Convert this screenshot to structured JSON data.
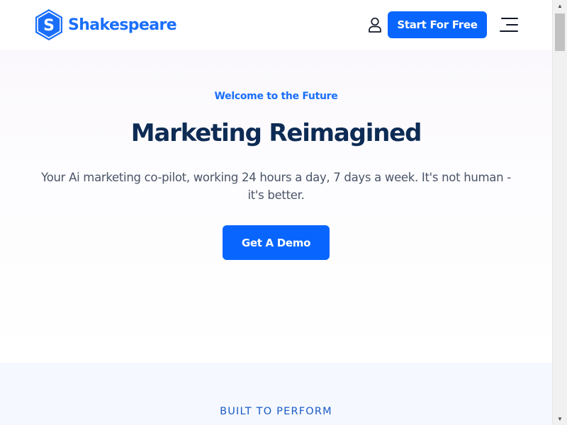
{
  "header": {
    "logo_text": "Shakespeare",
    "logo_letter": "S",
    "cta_label": "Start For Free",
    "account_icon": "user-icon",
    "menu_icon": "hamburger-menu-icon"
  },
  "hero": {
    "eyebrow": "Welcome to the Future",
    "title": "Marketing Reimagined",
    "subtitle": "Your Ai marketing co-pilot, working 24 hours a day, 7 days a week. It's not human - it's better.",
    "cta_label": "Get A Demo"
  },
  "section_two": {
    "label": "BUILT TO PERFORM"
  },
  "colors": {
    "brand_blue": "#0866ff",
    "logo_blue": "#1a6ffa",
    "heading_navy": "#0d2b54",
    "body_gray": "#4a5568"
  }
}
